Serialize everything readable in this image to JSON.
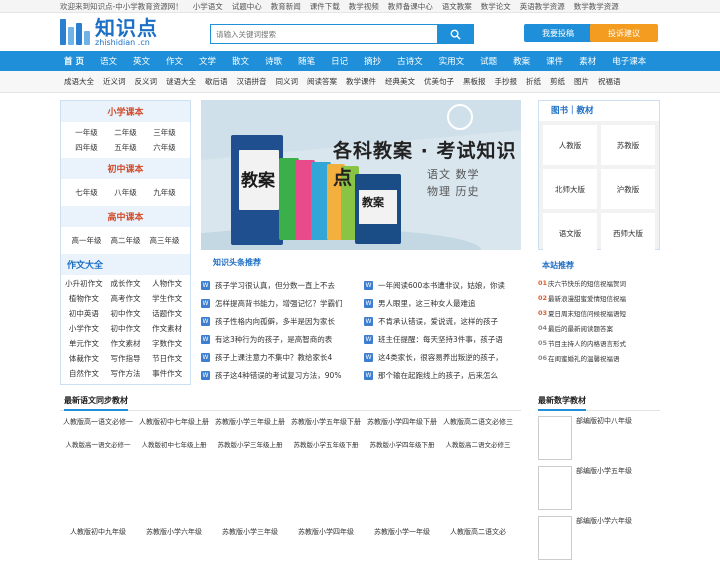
{
  "topbar": {
    "welcome": "欢迎来到知识点-中小学教育资源网！",
    "links": [
      "小学语文",
      "试题中心",
      "教育新闻",
      "课件下载",
      "教学视频",
      "教师备课中心",
      "语文教案",
      "数学论文",
      "英语教学资源",
      "数学教学资源"
    ]
  },
  "logo": {
    "cn": "知识点",
    "en": "zhishidian .cn"
  },
  "search": {
    "placeholder": "请输入关键词搜索"
  },
  "header_buttons": {
    "contribute": "我要投稿",
    "feedback": "投诉建议"
  },
  "nav": [
    "首 页",
    "语文",
    "英文",
    "作文",
    "文学",
    "散文",
    "诗歌",
    "随笔",
    "日记",
    "摘抄",
    "古诗文",
    "实用文",
    "试题",
    "教案",
    "课件",
    "素材",
    "电子课本"
  ],
  "subnav": [
    "成语大全",
    "近义词",
    "反义词",
    "谜语大全",
    "歇后语",
    "汉语拼音",
    "同义词",
    "阅读答案",
    "教学课件",
    "经典美文",
    "优美句子",
    "黑板报",
    "手抄报",
    "折纸",
    "剪纸",
    "图片",
    "祝福语"
  ],
  "left": {
    "primary_title": "小学课本",
    "primary": [
      "一年级",
      "二年级",
      "三年级",
      "四年级",
      "五年级",
      "六年级"
    ],
    "middle_title": "初中课本",
    "middle": [
      "七年级",
      "八年级",
      "九年级"
    ],
    "high_title": "高中课本",
    "high": [
      "高一年级",
      "高二年级",
      "高三年级"
    ],
    "comp_title": "作文大全",
    "comp": [
      "小升初作文",
      "成长作文",
      "人物作文",
      "植物作文",
      "高考作文",
      "学生作文",
      "初中英语",
      "初中作文",
      "话题作文",
      "小学作文",
      "初中作文",
      "作文素材",
      "单元作文",
      "作文素材",
      "字数作文",
      "体裁作文",
      "写作指导",
      "节日作文",
      "自然作文",
      "写作方法",
      "事件作文"
    ]
  },
  "banner": {
    "headline": "各科教案 · 考试知识点",
    "subjects_1": "语文  数学",
    "subjects_2": "物理  历史",
    "book_text": "教案"
  },
  "news": {
    "title": "知识头条推荐",
    "left": [
      "孩子学习很认真，但分数一直上不去",
      "怎样提高背书能力，增强记忆？学霸们",
      "孩子性格内向孤僻，多半是因为家长",
      "有这3种行为的孩子，是高智商的表",
      "孩子上课注意力不集中？教给家长4",
      "孩子这4种错误的考试复习方法，90%"
    ],
    "right": [
      "一年阅读600本书遭非议，姑娘，你读",
      "男人眼里，这三种女人最难追",
      "不肯承认错误，爱说谎，这样的孩子",
      "班主任提醒：每天坚持3件事，孩子语",
      "这4类家长，很容易养出叛逆的孩子，",
      "那个输在起跑线上的孩子，后来怎么"
    ]
  },
  "right": {
    "title": "图书｜教材",
    "items": [
      "人教版",
      "苏教版",
      "北师大版",
      "沪教版",
      "语文版",
      "西师大版"
    ],
    "hot_title": "本站推荐",
    "hot": [
      {
        "n": "01",
        "t": "庆六节快乐的短信祝福贺词"
      },
      {
        "n": "02",
        "t": "最新浪漫甜蜜爱情短信祝福"
      },
      {
        "n": "03",
        "t": "夏日周末短信问候祝福语短"
      },
      {
        "n": "04",
        "t": "最后的最新阅读题答案"
      },
      {
        "n": "05",
        "t": "节目主持人的内格语言形式"
      },
      {
        "n": "06",
        "t": "在闺蜜婚礼的温馨祝福语"
      }
    ]
  },
  "lower": {
    "yuwen_title": "最新语文同步教材",
    "math_title": "最新数学教材",
    "row1": [
      {
        "alt": "人教版高一语文必修一",
        "cap": "人教版高一语文必修一"
      },
      {
        "alt": "人教版初中七年级上册",
        "cap": "人教版初中七年级上册"
      },
      {
        "alt": "苏教版小学三年级上册",
        "cap": "苏教版小学三年级上册"
      },
      {
        "alt": "苏教版小学五年级下册",
        "cap": "苏教版小学五年级下册"
      },
      {
        "alt": "苏教版小学四年级下册",
        "cap": "苏教版小学四年级下册"
      },
      {
        "alt": "人教版高二语文必修三",
        "cap": "人教版高二语文必修三"
      }
    ],
    "row2": [
      {
        "alt": "人教版初中九年级"
      },
      {
        "alt": "苏教版小学六年级"
      },
      {
        "alt": "苏教版小学三年级"
      },
      {
        "alt": "苏教版小学四年级"
      },
      {
        "alt": "苏教版小学一年级"
      },
      {
        "alt": "人教版高二语文必"
      }
    ],
    "math": [
      "部编版初中八年级",
      "部编版小学五年级",
      "部编版小学六年级"
    ]
  },
  "colors": {
    "accent": "#1e8fd8",
    "orange": "#f39c20",
    "title_red": "#d24a2a"
  }
}
